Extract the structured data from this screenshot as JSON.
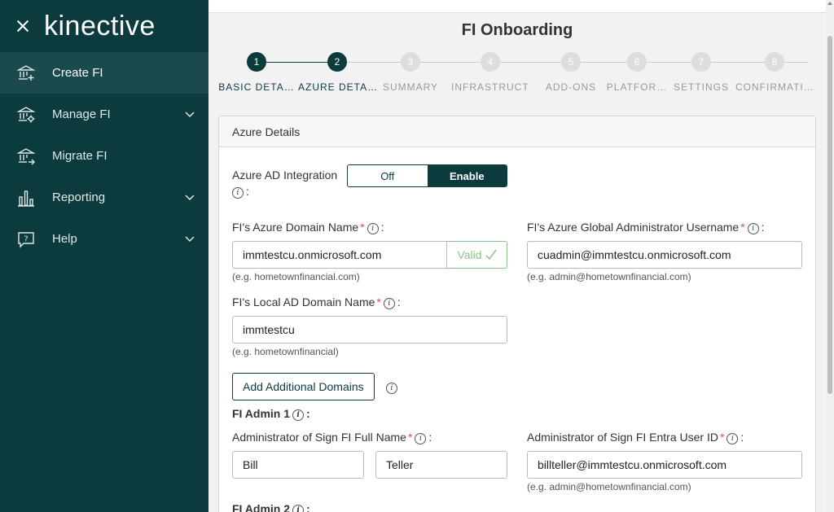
{
  "sidebar": {
    "logo": "kinective",
    "items": [
      {
        "label": "Create FI",
        "icon": "bank-plus-icon",
        "active": true,
        "expandable": false
      },
      {
        "label": "Manage FI",
        "icon": "bank-gear-icon",
        "active": false,
        "expandable": true
      },
      {
        "label": "Migrate FI",
        "icon": "bank-arrow-icon",
        "active": false,
        "expandable": false
      },
      {
        "label": "Reporting",
        "icon": "bar-chart-icon",
        "active": false,
        "expandable": true
      },
      {
        "label": "Help",
        "icon": "help-bubble-icon",
        "active": false,
        "expandable": true
      }
    ]
  },
  "page": {
    "title": "FI Onboarding"
  },
  "stepper": {
    "current": 2,
    "steps": [
      {
        "num": "1",
        "label": "BASIC DETA…"
      },
      {
        "num": "2",
        "label": "AZURE DETA…"
      },
      {
        "num": "3",
        "label": "SUMMARY"
      },
      {
        "num": "4",
        "label": "INFRASTRUCT…"
      },
      {
        "num": "5",
        "label": "ADD-ONS"
      },
      {
        "num": "6",
        "label": "PLATFOR…"
      },
      {
        "num": "7",
        "label": "SETTINGS"
      },
      {
        "num": "8",
        "label": "CONFIRMATI…"
      }
    ]
  },
  "card": {
    "title": "Azure Details",
    "ad_integration": {
      "label": "Azure AD Integration",
      "colon": ":",
      "off_label": "Off",
      "on_label": "Enable",
      "selected": "Enable"
    },
    "azure_domain": {
      "label": "FI's Azure Domain Name",
      "value": "immtestcu.onmicrosoft.com",
      "status": "Valid",
      "hint": "(e.g. hometownfinancial.com)"
    },
    "global_admin": {
      "label": "FI's Azure Global Administrator Username",
      "value": "cuadmin@immtestcu.onmicrosoft.com",
      "hint": "(e.g. admin@hometownfinancial.com)"
    },
    "local_ad": {
      "label": "FI's Local AD Domain Name",
      "value": "immtestcu",
      "hint": "(e.g. hometownfinancial)"
    },
    "add_domains_label": "Add Additional Domains",
    "admin1": {
      "heading": "FI Admin 1",
      "full_name_label": "Administrator of Sign FI Full Name",
      "first_name": "Bill",
      "last_name": "Teller",
      "entra_label": "Administrator of Sign FI Entra User ID",
      "entra_value": "billteller@immtestcu.onmicrosoft.com",
      "entra_hint": "(e.g. admin@hometownfinancial.com)"
    },
    "admin2": {
      "heading": "FI Admin 2"
    }
  },
  "colors": {
    "sidebar_bg": "#0c3b3e",
    "accent": "#0c3b3e",
    "valid": "#8bc48a",
    "required": "#d9534f"
  }
}
